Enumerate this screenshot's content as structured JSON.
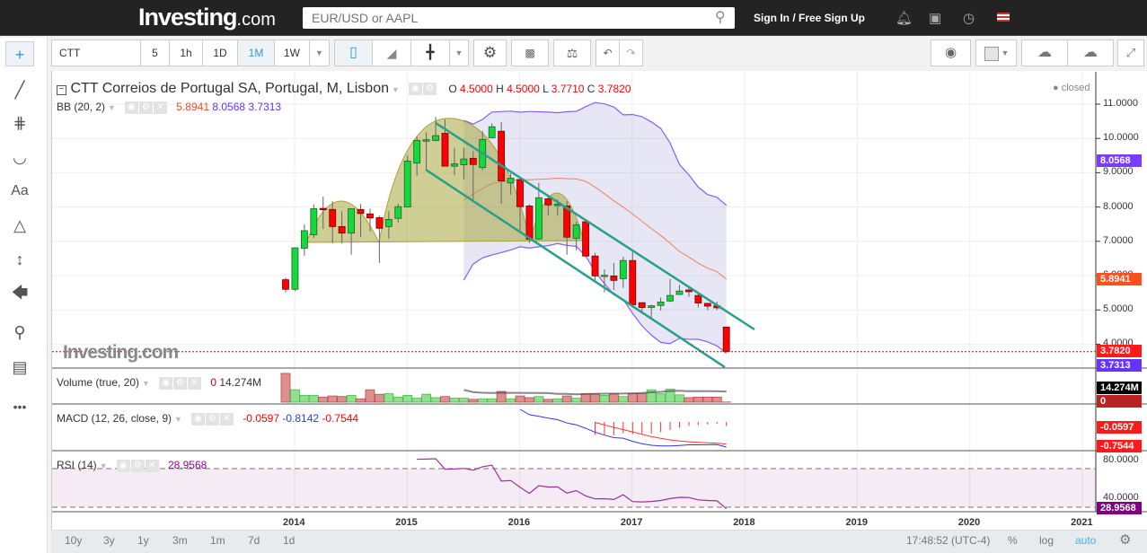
{
  "header": {
    "logo": "Investing",
    "logo_suffix": ".com",
    "search_placeholder": "EUR/USD or AAPL",
    "signin": "Sign In / Free Sign Up"
  },
  "toolbar": {
    "symbol": "CTT",
    "intervals": [
      "5",
      "1h",
      "1D",
      "1M",
      "1W"
    ],
    "active_interval": "1M"
  },
  "legend": {
    "title": "CTT Correios de Portugal SA, Portugal, M, Lisbon",
    "o_label": "O",
    "o": "4.5000",
    "h_label": "H",
    "h": "4.5000",
    "l_label": "L",
    "l": "3.7710",
    "c_label": "C",
    "c": "3.7820",
    "status": "closed"
  },
  "bb": {
    "label": "BB (20, 2)",
    "mid": "5.8941",
    "upper": "8.0568",
    "lower": "3.7313"
  },
  "volume": {
    "label": "Volume (true, 20)",
    "value": "0",
    "ma": "14.274M"
  },
  "macd": {
    "label": "MACD (12, 26, close, 9)",
    "hist": "-0.0597",
    "macd": "-0.8142",
    "signal": "-0.7544"
  },
  "rsi": {
    "label": "RSI (14)",
    "value": "28.9568",
    "axis": [
      "80.0000",
      "40.0000"
    ]
  },
  "price_axis": [
    "11.0000",
    "10.0000",
    "9.0000",
    "8.0000",
    "7.0000",
    "6.0000",
    "5.0000",
    "4.0000"
  ],
  "tags": {
    "upper": "8.0568",
    "mid": "5.8941",
    "close": "3.7820",
    "lower": "3.7313",
    "vol_ma": "14.274M",
    "vol": "0",
    "hist": "-0.0597",
    "signal": "-0.7544",
    "rsi": "28.9568"
  },
  "watermark": "Investing.com",
  "years": [
    "2014",
    "2015",
    "2016",
    "2017",
    "2018",
    "2019",
    "2020",
    "2021"
  ],
  "ranges": [
    "10y",
    "3y",
    "1y",
    "3m",
    "1m",
    "7d",
    "1d"
  ],
  "footer": {
    "time": "17:48:52 (UTC-4)",
    "pct": "%",
    "log": "log",
    "auto": "auto"
  },
  "colors": {
    "up": "#14d93c",
    "down": "#ff0000",
    "bb_band": "#8a5cf6",
    "bb_mid": "#f08060",
    "macd": "#3333ff",
    "signal": "#ff3333",
    "rsi": "#993399",
    "pattern": "#a8a53c",
    "channel": "#26a08a"
  },
  "chart_data": {
    "type": "candlestick",
    "start_month": "2013-12",
    "interval": "1M",
    "ohlc": [
      [
        5.88,
        5.94,
        5.51,
        5.6
      ],
      [
        5.6,
        6.81,
        5.55,
        6.81
      ],
      [
        6.8,
        7.49,
        6.58,
        7.31
      ],
      [
        7.19,
        8.08,
        7.1,
        7.95
      ],
      [
        7.96,
        8.3,
        7.36,
        7.94
      ],
      [
        7.93,
        8.17,
        6.94,
        7.43
      ],
      [
        7.43,
        7.88,
        6.94,
        7.24
      ],
      [
        7.24,
        7.95,
        6.61,
        7.95
      ],
      [
        7.93,
        8.09,
        7.13,
        7.81
      ],
      [
        7.8,
        7.95,
        7.29,
        7.68
      ],
      [
        7.69,
        7.75,
        6.37,
        7.38
      ],
      [
        7.43,
        7.88,
        7.08,
        7.64
      ],
      [
        7.67,
        8.1,
        7.54,
        8.01
      ],
      [
        8.0,
        9.5,
        8.0,
        9.34
      ],
      [
        9.28,
        10.04,
        8.91,
        9.94
      ],
      [
        9.94,
        10.18,
        9.06,
        9.96
      ],
      [
        9.94,
        10.63,
        9.92,
        10.08
      ],
      [
        10.15,
        10.55,
        9.19,
        9.19
      ],
      [
        9.19,
        9.72,
        8.93,
        9.26
      ],
      [
        9.23,
        9.72,
        8.8,
        9.4
      ],
      [
        9.42,
        9.63,
        8.15,
        9.24
      ],
      [
        9.15,
        10.21,
        9.08,
        9.97
      ],
      [
        10.02,
        10.44,
        10.0,
        10.34
      ],
      [
        10.21,
        10.48,
        8.09,
        8.76
      ],
      [
        8.7,
        8.98,
        8.36,
        8.84
      ],
      [
        8.8,
        8.82,
        7.32,
        8.01
      ],
      [
        8.03,
        8.08,
        6.95,
        7.06
      ],
      [
        7.07,
        8.71,
        7.05,
        8.27
      ],
      [
        8.24,
        8.36,
        7.75,
        8.06
      ],
      [
        8.06,
        8.22,
        7.75,
        8.08
      ],
      [
        8.03,
        8.17,
        6.61,
        7.12
      ],
      [
        7.09,
        7.57,
        6.74,
        7.48
      ],
      [
        7.57,
        7.58,
        6.57,
        6.57
      ],
      [
        6.57,
        6.66,
        5.83,
        5.99
      ],
      [
        5.99,
        6.18,
        5.51,
        6.01
      ],
      [
        5.99,
        6.37,
        5.58,
        5.86
      ],
      [
        5.91,
        6.55,
        5.64,
        6.44
      ],
      [
        6.44,
        6.69,
        5.15,
        5.15
      ],
      [
        5.21,
        5.21,
        4.89,
        5.07
      ],
      [
        5.07,
        5.15,
        4.74,
        5.12
      ],
      [
        5.13,
        5.36,
        4.98,
        5.23
      ],
      [
        5.26,
        5.9,
        5.23,
        5.42
      ],
      [
        5.45,
        5.73,
        5.44,
        5.55
      ],
      [
        5.58,
        5.63,
        5.38,
        5.53
      ],
      [
        5.42,
        5.47,
        5.07,
        5.2
      ],
      [
        5.19,
        5.19,
        4.99,
        5.11
      ],
      [
        5.12,
        5.24,
        4.99,
        5.06
      ],
      [
        4.5,
        4.5,
        3.771,
        3.782
      ]
    ],
    "volume_millions": [
      51,
      22,
      12,
      12,
      9,
      11,
      10,
      12,
      6,
      22,
      14,
      15,
      9,
      12,
      7,
      14,
      8,
      10,
      7,
      7,
      5,
      6,
      6,
      19,
      6,
      11,
      8,
      10,
      5,
      6,
      11,
      7,
      15,
      15,
      12,
      15,
      10,
      15,
      15,
      22,
      15,
      23,
      13,
      8,
      9,
      9,
      9,
      0.3
    ],
    "ylim": [
      3.5,
      11.5
    ],
    "rsi_lim": [
      25,
      85
    ]
  }
}
